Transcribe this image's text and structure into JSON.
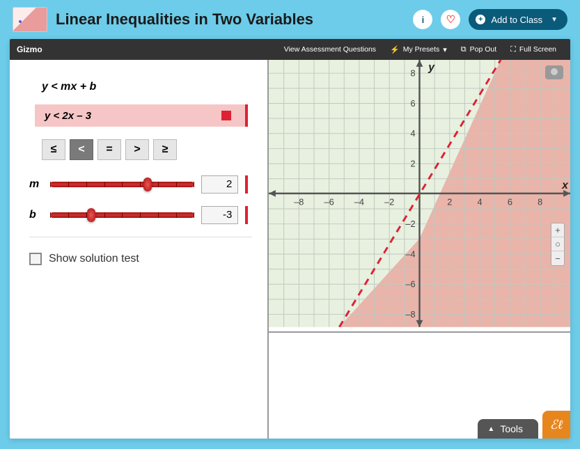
{
  "header": {
    "title": "Linear Inequalities in Two Variables",
    "add_label": "Add to Class"
  },
  "gizmobar": {
    "brand": "Gizmo",
    "assessment": "View Assessment Questions",
    "presets": "My Presets",
    "popout": "Pop Out",
    "fullscreen": "Full Screen"
  },
  "panel": {
    "general_formula": "y < mx + b",
    "current_formula": "y < 2x – 3",
    "operators": {
      "le": "≤",
      "lt": "<",
      "eq": "=",
      "gt": ">",
      "ge": "≥"
    },
    "selected_op": "lt",
    "m": {
      "label": "m",
      "value": "2",
      "pos_pct": 62
    },
    "b": {
      "label": "b",
      "value": "-3",
      "pos_pct": 26
    },
    "show_solution_label": "Show solution test"
  },
  "graph": {
    "x_label": "x",
    "y_label": "y",
    "ticks": {
      "neg": [
        "–8",
        "–6",
        "–4",
        "–2"
      ],
      "pos": [
        "2",
        "4",
        "6",
        "8"
      ]
    }
  },
  "tools": {
    "label": "Tools"
  },
  "chart_data": {
    "type": "line",
    "inequality": "y < 2x - 3",
    "boundary": {
      "m": 2,
      "b": -3,
      "style": "dashed"
    },
    "shaded_region": "below",
    "xlim": [
      -9,
      9
    ],
    "ylim": [
      -9,
      9
    ],
    "x_ticks": [
      -8,
      -6,
      -4,
      -2,
      2,
      4,
      6,
      8
    ],
    "y_ticks": [
      -8,
      -6,
      -4,
      -2,
      2,
      4,
      6,
      8
    ]
  }
}
